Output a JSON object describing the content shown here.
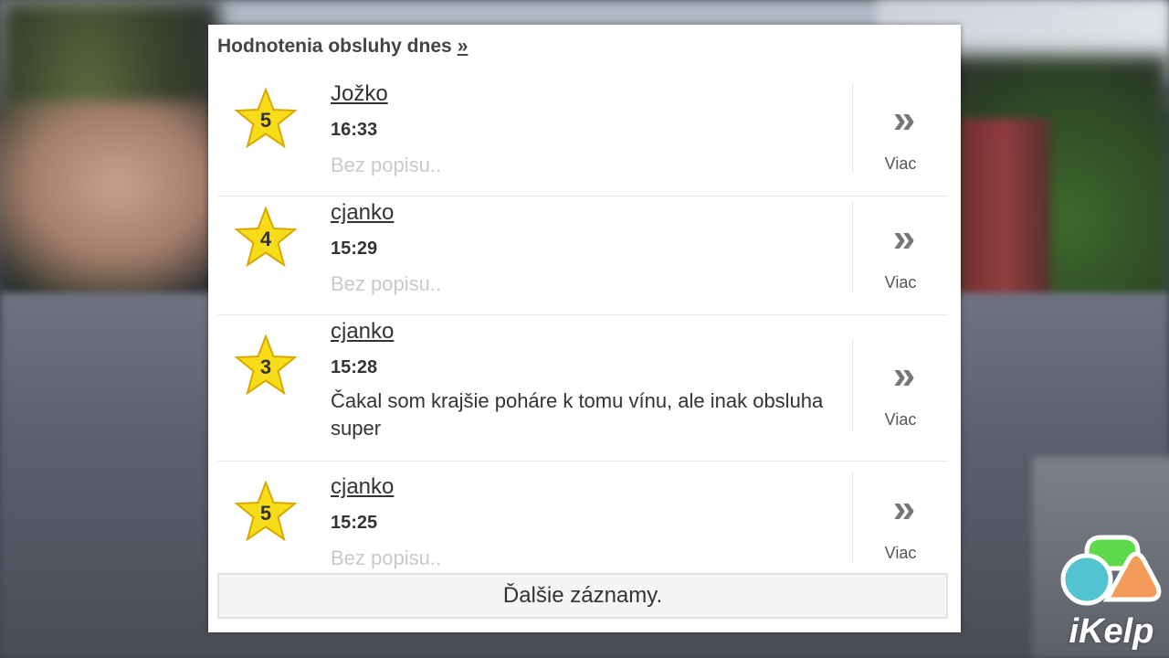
{
  "header": {
    "title": "Hodnotenia obsluhy dnes",
    "more_link": "»"
  },
  "reviews": [
    {
      "rating": "5",
      "user": "Jožko",
      "time": "16:33",
      "description": "Bez popisu..",
      "has_description": false,
      "more_label": "Viac"
    },
    {
      "rating": "4",
      "user": "cjanko",
      "time": "15:29",
      "description": "Bez popisu..",
      "has_description": false,
      "more_label": "Viac"
    },
    {
      "rating": "3",
      "user": "cjanko",
      "time": "15:28",
      "description": "Čakal som krajšie poháre k tomu vínu, ale inak obsluha super",
      "has_description": true,
      "more_label": "Viac"
    },
    {
      "rating": "5",
      "user": "cjanko",
      "time": "15:25",
      "description": "Bez popisu..",
      "has_description": false,
      "more_label": "Viac"
    }
  ],
  "more_icon": "double-chevron-right-icon",
  "load_more_label": "Ďalšie záznamy.",
  "logo": {
    "text": "iKelp"
  },
  "colors": {
    "star_fill": "#f7dc1a",
    "star_stroke": "#d9a800",
    "placeholder_text": "#c9c9c9",
    "logo_green": "#5fd84a",
    "logo_cyan": "#53c3d2",
    "logo_orange": "#f29a58"
  }
}
